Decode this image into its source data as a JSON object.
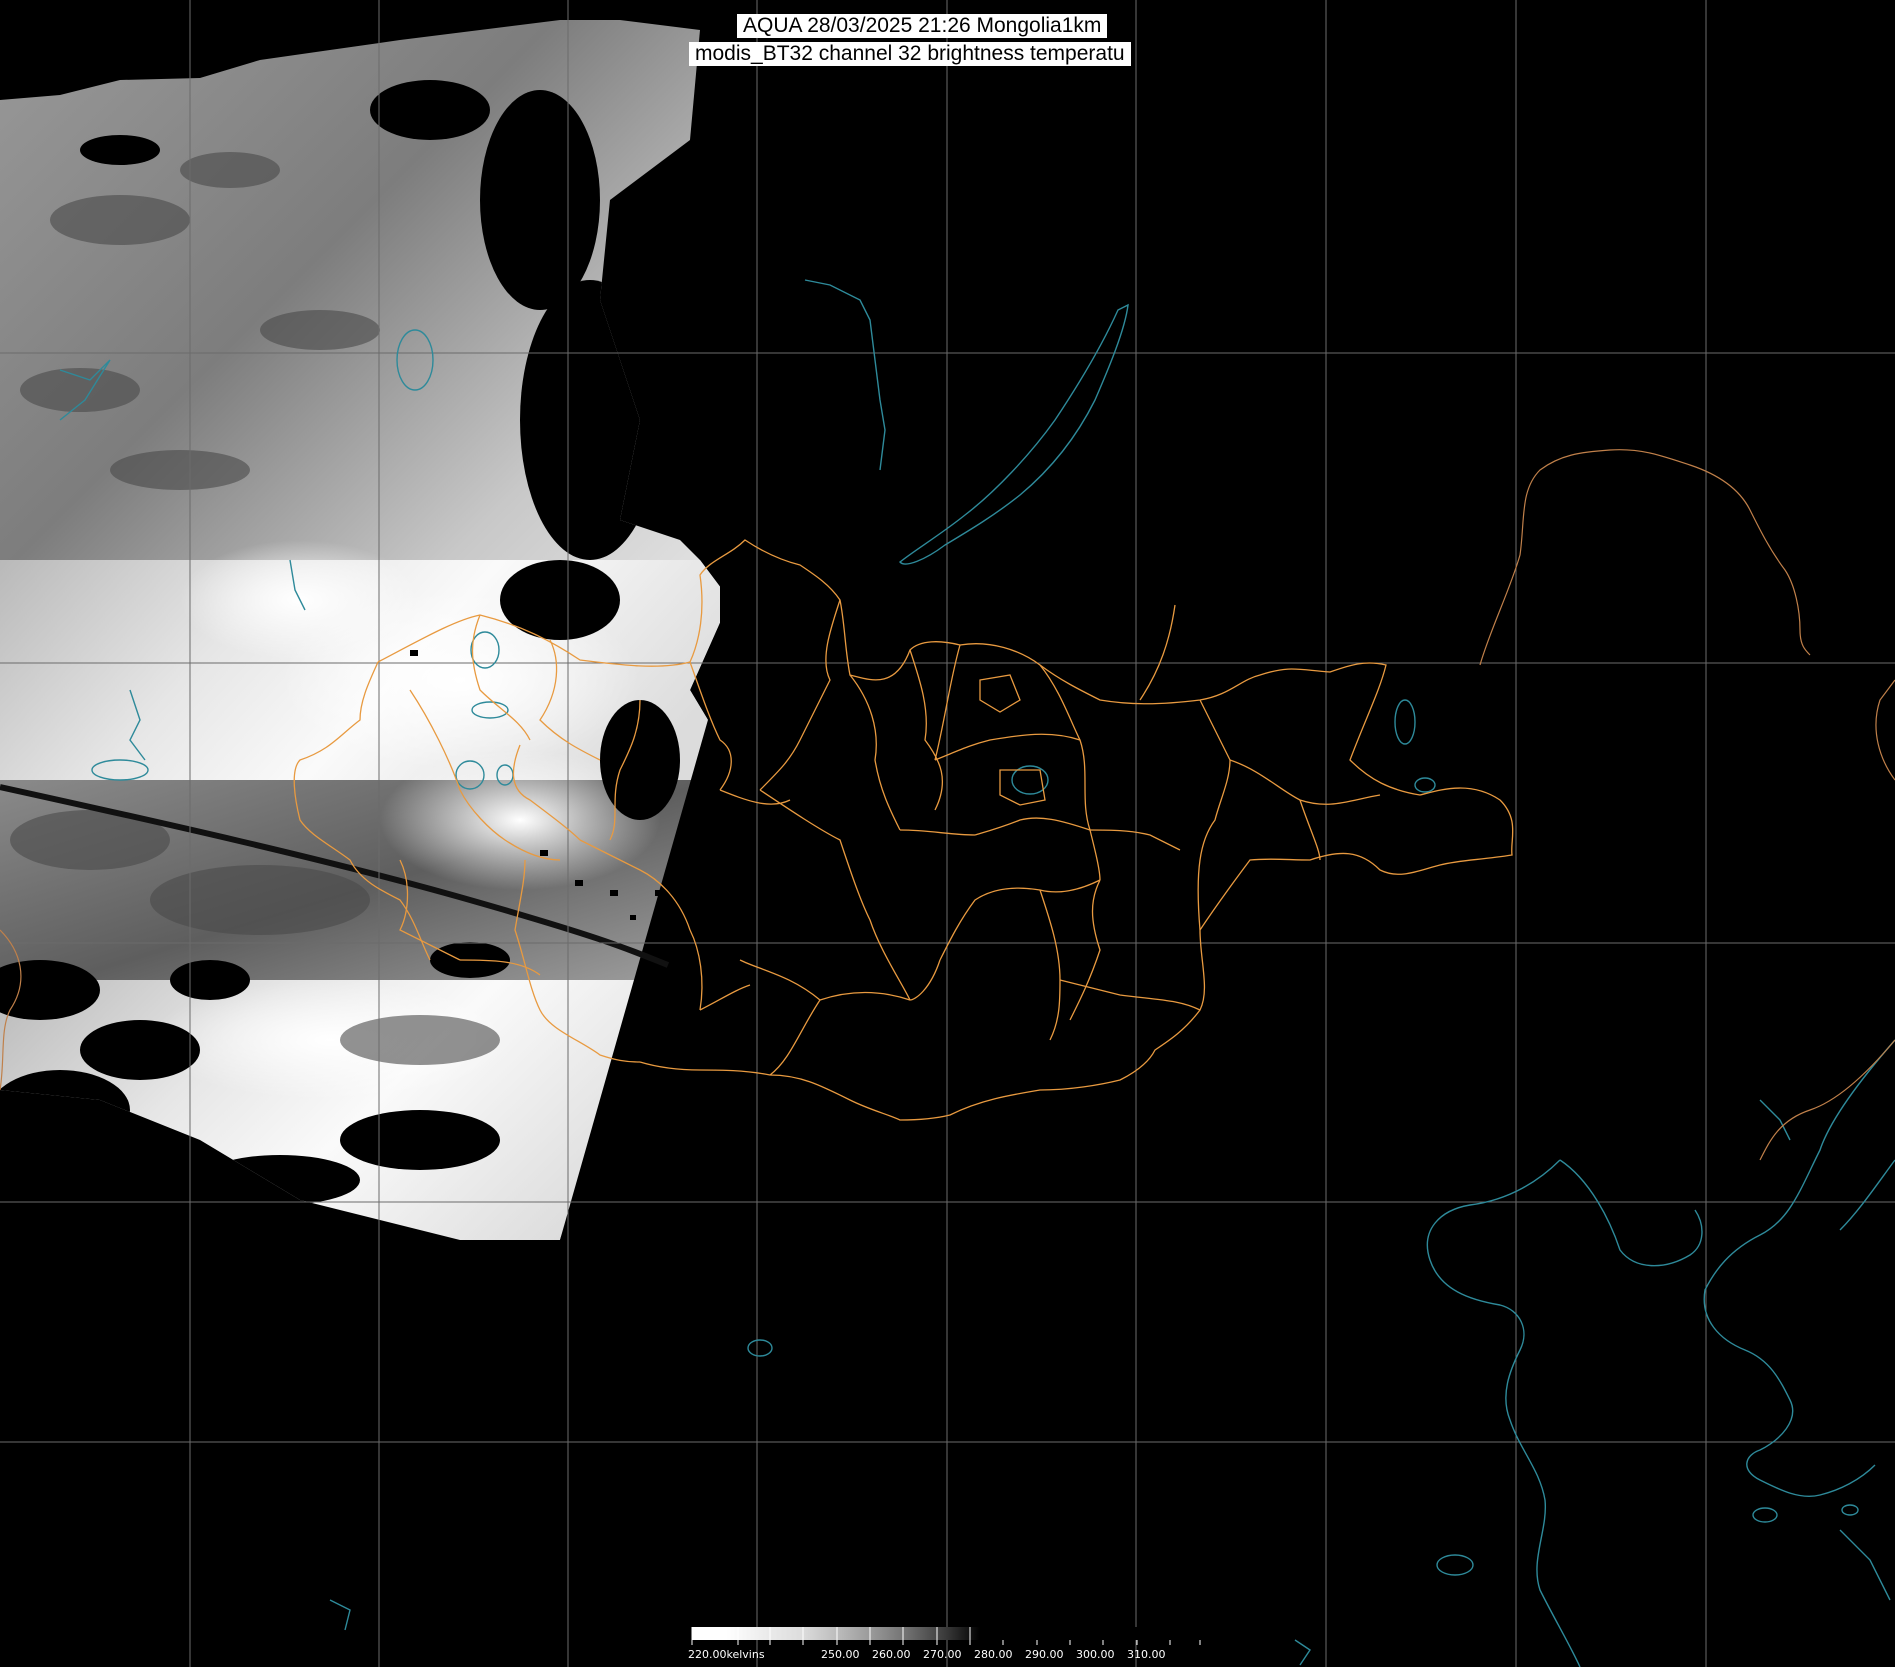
{
  "title": {
    "line1": "AQUA 28/03/2025 21:26 Mongolia1km",
    "line2": "modis_BT32 channel 32 brightness temperatu"
  },
  "colorbar": {
    "unit_label": "220.00kelvins",
    "ticks": [
      "250.00",
      "260.00",
      "270.00",
      "280.00",
      "290.00",
      "300.00",
      "310.00"
    ],
    "gradient": [
      "#ffffff",
      "#ffffff",
      "#ececec",
      "#dddddd",
      "#bdbdbd",
      "#9a9a9a",
      "#6f6f6f",
      "#3a3a3a",
      "#000000"
    ]
  },
  "colors": {
    "background": "#000000",
    "graticule": "#6b6b6b",
    "admin_boundaries": "#e89a40",
    "coastlines_lakes": "#2e8a9a",
    "swath_track": "#111111"
  }
}
